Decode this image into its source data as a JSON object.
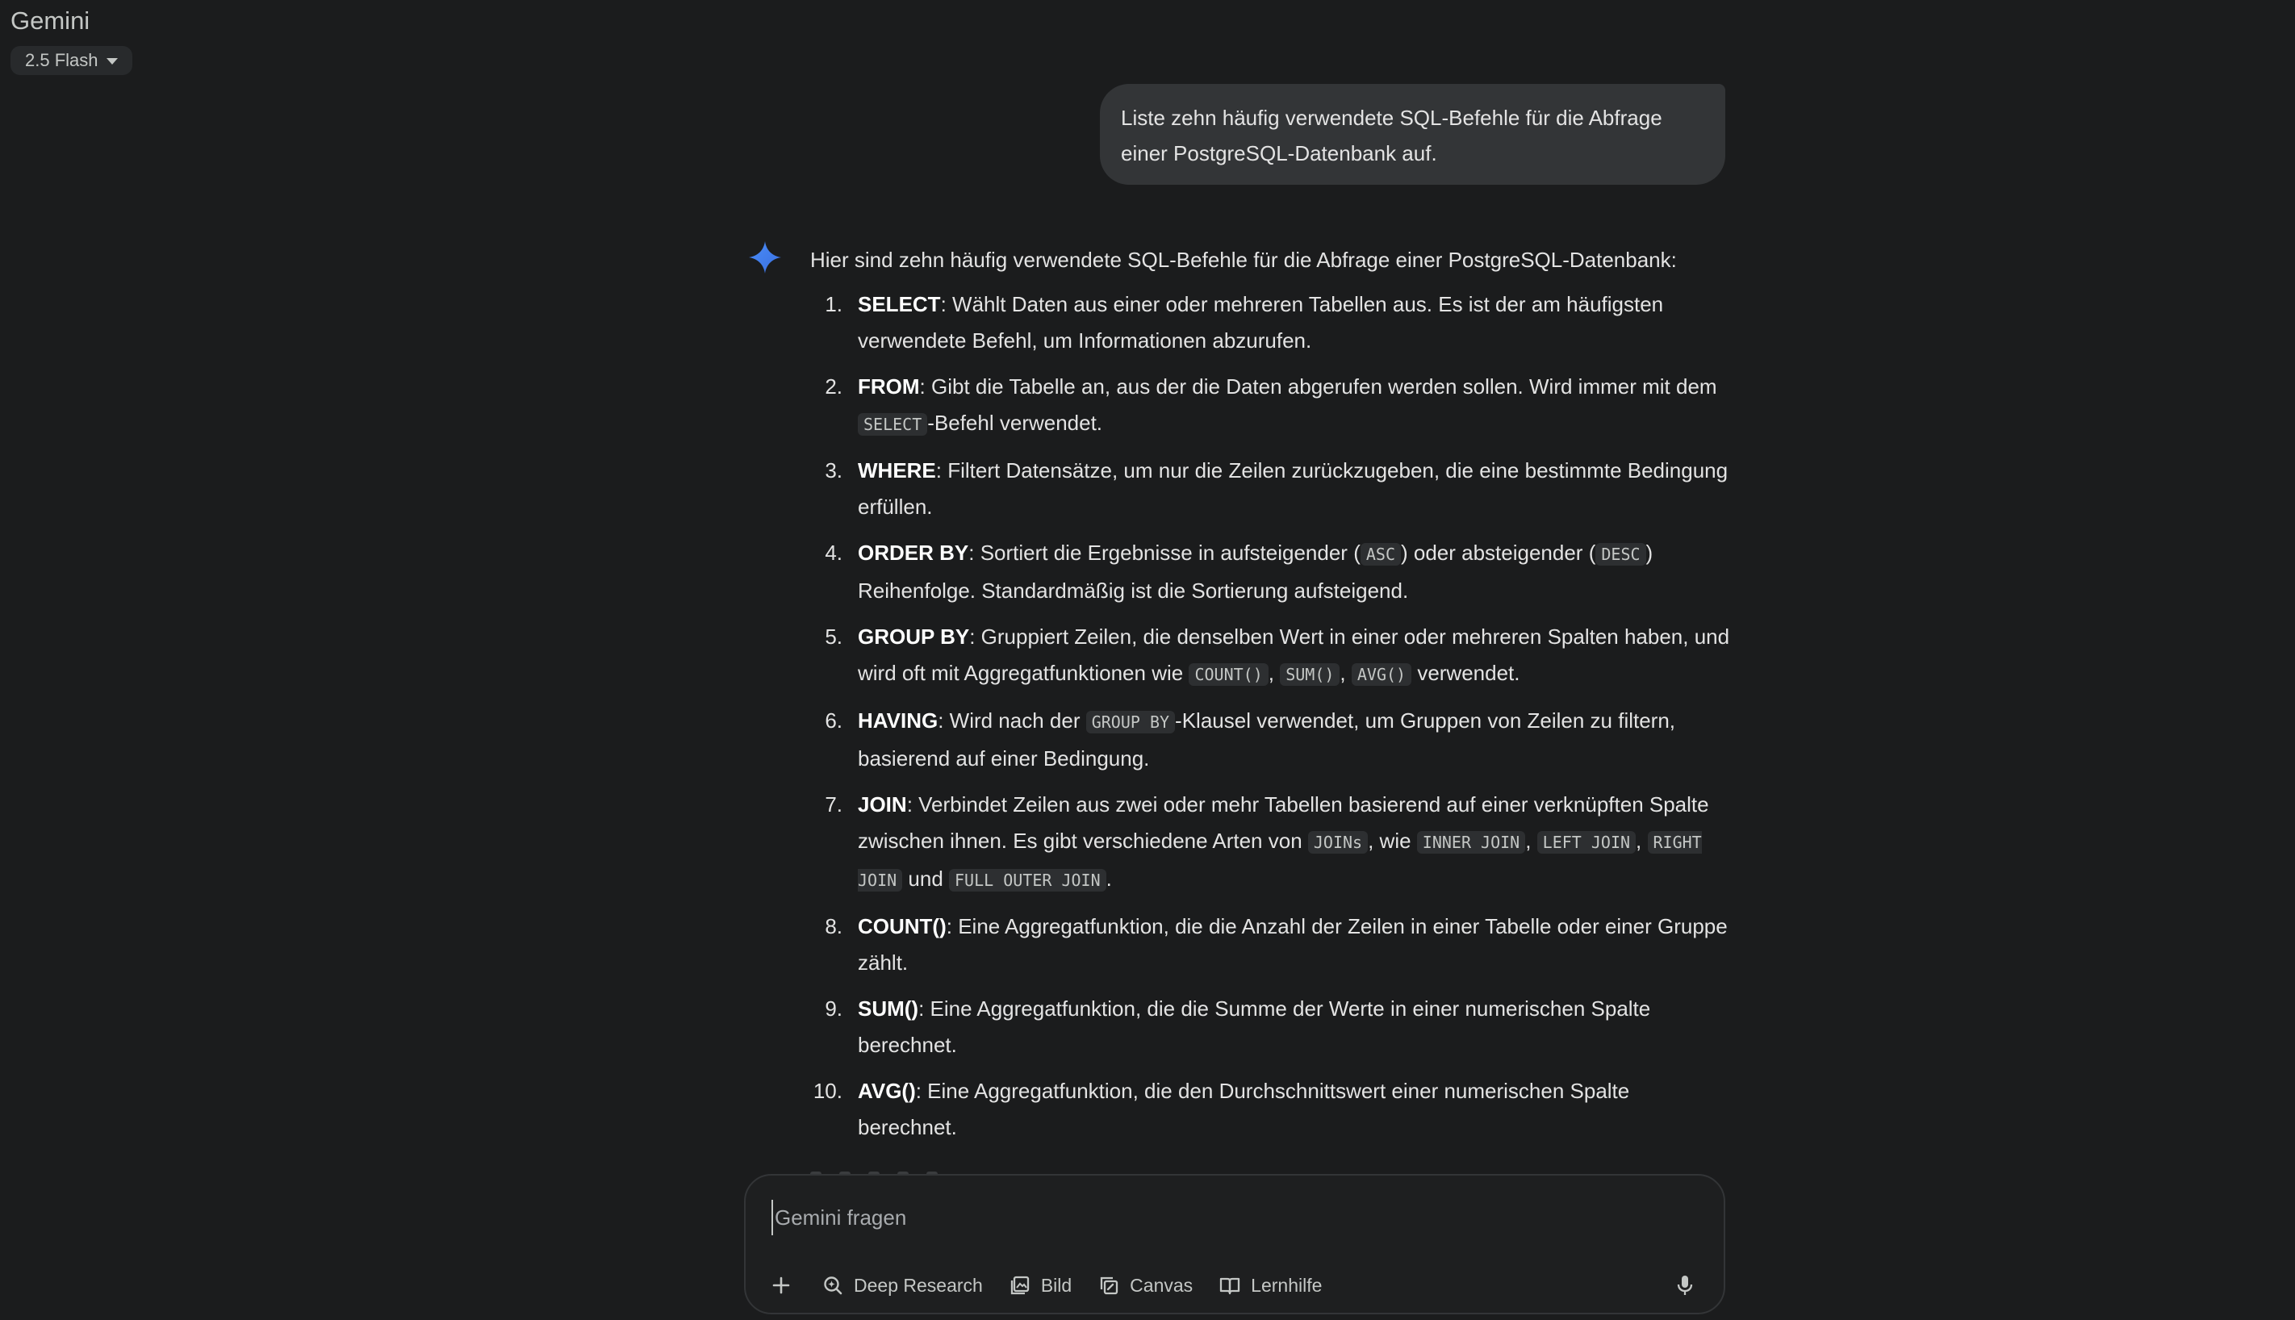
{
  "app": {
    "title": "Gemini",
    "model_label": "2.5 Flash"
  },
  "user_message": "Liste zehn häufig verwendete SQL-Befehle für die Abfrage einer PostgreSQL-Datenbank auf.",
  "response": {
    "intro": "Hier sind zehn häufig verwendete SQL-Befehle für die Abfrage einer PostgreSQL-Datenbank:",
    "items": [
      {
        "num": "1.",
        "term": "SELECT"
      },
      {
        "num": "2.",
        "term": "FROM"
      },
      {
        "num": "3.",
        "term": "WHERE"
      },
      {
        "num": "4.",
        "term": "ORDER BY"
      },
      {
        "num": "5.",
        "term": "GROUP BY"
      },
      {
        "num": "6.",
        "term": "HAVING"
      },
      {
        "num": "7.",
        "term": "JOIN"
      },
      {
        "num": "8.",
        "term": "COUNT()"
      },
      {
        "num": "9.",
        "term": "SUM()"
      },
      {
        "num": "10.",
        "term": "AVG()"
      }
    ],
    "text": {
      "i1": ": Wählt Daten aus einer oder mehreren Tabellen aus. Es ist der am häufigsten verwendete Befehl, um Informationen abzurufen.",
      "i2a": ": Gibt die Tabelle an, aus der die Daten abgerufen werden sollen. Wird immer mit dem ",
      "i2code": "SELECT",
      "i2b": "-Befehl verwendet.",
      "i3": ": Filtert Datensätze, um nur die Zeilen zurückzugeben, die eine bestimmte Bedingung erfüllen.",
      "i4a": ": Sortiert die Ergebnisse in aufsteigender (",
      "i4code1": "ASC",
      "i4b": ") oder absteigender (",
      "i4code2": "DESC",
      "i4c": ") Reihenfolge. Standardmäßig ist die Sortierung aufsteigend.",
      "i5a": ": Gruppiert Zeilen, die denselben Wert in einer oder mehreren Spalten haben, und wird oft mit Aggregatfunktionen wie ",
      "i5code1": "COUNT()",
      "i5sep1": ", ",
      "i5code2": "SUM()",
      "i5sep2": ", ",
      "i5code3": "AVG()",
      "i5b": " verwendet.",
      "i6a": ": Wird nach der ",
      "i6code": "GROUP BY",
      "i6b": "-Klausel verwendet, um Gruppen von Zeilen zu filtern, basierend auf einer Bedingung.",
      "i7a": ": Verbindet Zeilen aus zwei oder mehr Tabellen basierend auf einer verknüpften Spalte zwischen ihnen. Es gibt verschiedene Arten von ",
      "i7code1": "JOINs",
      "i7b": ", wie ",
      "i7code2": "INNER JOIN",
      "i7sep1": ", ",
      "i7code3": "LEFT JOIN",
      "i7sep2": ", ",
      "i7code4": "RIGHT JOIN",
      "i7c": " und ",
      "i7code5": "FULL OUTER JOIN",
      "i7d": ".",
      "i8": ": Eine Aggregatfunktion, die die Anzahl der Zeilen in einer Tabelle oder einer Gruppe zählt.",
      "i9": ": Eine Aggregatfunktion, die die Summe der Werte in einer numerischen Spalte berechnet.",
      "i10": ": Eine Aggregatfunktion, die den Durchschnittswert einer numerischen Spalte berechnet."
    }
  },
  "composer": {
    "placeholder": "Gemini fragen",
    "value": "",
    "tools": {
      "deep_research": "Deep Research",
      "image": "Bild",
      "canvas": "Canvas",
      "learning": "Lernhilfe"
    }
  },
  "icons": {
    "spark": "gemini-spark-icon",
    "plus": "plus-icon",
    "deep_research": "deep-research-icon",
    "image": "image-icon",
    "canvas": "canvas-icon",
    "learning": "book-icon",
    "mic": "microphone-icon"
  },
  "colors": {
    "background": "#1b1c1d",
    "user_bubble": "#333537",
    "spark_blue": "#4a8df8",
    "text": "#e3e3e3"
  }
}
